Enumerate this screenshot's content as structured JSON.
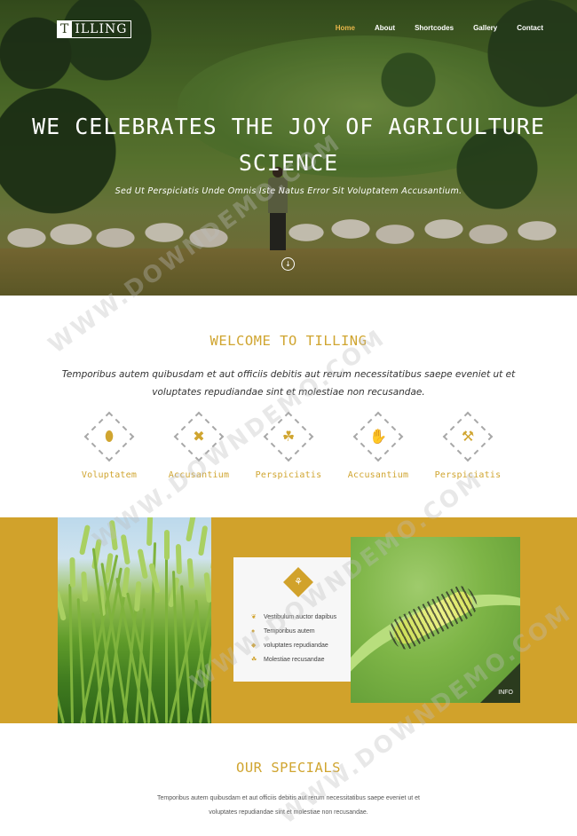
{
  "brand": {
    "logo_first": "T",
    "logo_rest": "ILLING"
  },
  "nav": {
    "items": [
      "Home",
      "About",
      "Shortcodes",
      "Gallery",
      "Contact"
    ],
    "active": "Home"
  },
  "hero": {
    "title_line1": "WE CELEBRATES THE JOY OF AGRICULTURE",
    "title_line2": "SCIENCE",
    "subtitle": "Sed Ut Perspiciatis Unde Omnis Iste Natus Error Sit Voluptatem Accusantium.",
    "scroll_icon": "arrow-down-circle-icon"
  },
  "welcome": {
    "title": "WELCOME TO TILLING",
    "lead": "Temporibus autem quibusdam et aut officiis debitis aut rerum necessitatibus saepe eveniet ut et voluptates repudiandae sint et molestiae non recusandae.",
    "features": [
      {
        "label": "Voluptatem",
        "icon": "coffee-beans-icon"
      },
      {
        "label": "Accusantium",
        "icon": "windmill-icon"
      },
      {
        "label": "Perspiciatis",
        "icon": "plant-sprout-icon"
      },
      {
        "label": "Accusantium",
        "icon": "hand-plant-icon"
      },
      {
        "label": "Perspiciatis",
        "icon": "farmer-icon"
      }
    ]
  },
  "info_card": {
    "badge_icon": "wheat-icon",
    "items": [
      {
        "text": "Vestibulum auctor dapibus",
        "icon": "leaf-icon"
      },
      {
        "text": "Temporibus autem",
        "icon": "drop-icon"
      },
      {
        "text": "voluptates repudiandae",
        "icon": "seed-icon"
      },
      {
        "text": "Molestiae recusandae",
        "icon": "sprout-icon"
      }
    ]
  },
  "photo_badge": {
    "label": "INFO"
  },
  "specials": {
    "title": "OUR SPECIALS",
    "text_line1": "Temporibus autem quibusdam et aut officiis debitis aut rerum necessitatibus saepe eveniet ut et",
    "text_line2": "voluptates repudiandae sint et molestiae non recusandae."
  },
  "watermark": {
    "text": "WWW.DOWNDEMO.COM"
  },
  "colors": {
    "accent": "#d1a22b",
    "nav_active": "#e8b64a",
    "card_bg": "#f7f7f7"
  }
}
